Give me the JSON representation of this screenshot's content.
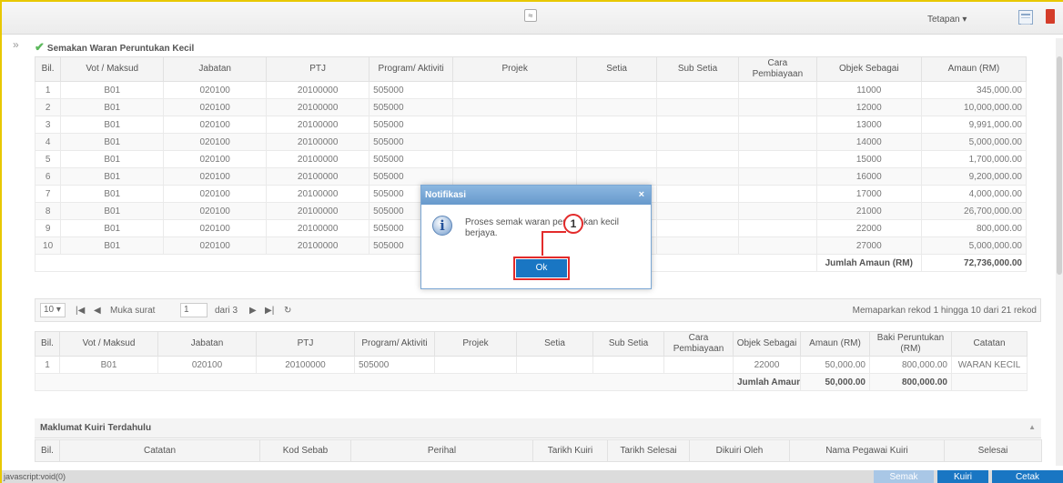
{
  "topbar": {
    "tetapan_label": "Tetapan ▾",
    "collapse_glyph": "≈"
  },
  "section": {
    "title": "Semakan Waran Peruntukan Kecil",
    "sidebar_toggle": "»"
  },
  "table1": {
    "headers": [
      "Bil.",
      "Vot / Maksud",
      "Jabatan",
      "PTJ",
      "Program/ Aktiviti",
      "Projek",
      "Setia",
      "Sub Setia",
      "Cara Pembiayaan",
      "Objek Sebagai",
      "Amaun (RM)"
    ],
    "rows": [
      [
        "1",
        "B01",
        "020100",
        "20100000",
        "505000",
        "",
        "",
        "",
        "",
        "11000",
        "345,000.00"
      ],
      [
        "2",
        "B01",
        "020100",
        "20100000",
        "505000",
        "",
        "",
        "",
        "",
        "12000",
        "10,000,000.00"
      ],
      [
        "3",
        "B01",
        "020100",
        "20100000",
        "505000",
        "",
        "",
        "",
        "",
        "13000",
        "9,991,000.00"
      ],
      [
        "4",
        "B01",
        "020100",
        "20100000",
        "505000",
        "",
        "",
        "",
        "",
        "14000",
        "5,000,000.00"
      ],
      [
        "5",
        "B01",
        "020100",
        "20100000",
        "505000",
        "",
        "",
        "",
        "",
        "15000",
        "1,700,000.00"
      ],
      [
        "6",
        "B01",
        "020100",
        "20100000",
        "505000",
        "",
        "",
        "",
        "",
        "16000",
        "9,200,000.00"
      ],
      [
        "7",
        "B01",
        "020100",
        "20100000",
        "505000",
        "",
        "",
        "",
        "",
        "17000",
        "4,000,000.00"
      ],
      [
        "8",
        "B01",
        "020100",
        "20100000",
        "505000",
        "",
        "",
        "",
        "",
        "21000",
        "26,700,000.00"
      ],
      [
        "9",
        "B01",
        "020100",
        "20100000",
        "505000",
        "",
        "",
        "",
        "",
        "22000",
        "800,000.00"
      ],
      [
        "10",
        "B01",
        "020100",
        "20100000",
        "505000",
        "",
        "",
        "",
        "",
        "27000",
        "5,000,000.00"
      ]
    ],
    "total_label": "Jumlah Amaun (RM)",
    "total_value": "72,736,000.00"
  },
  "pager": {
    "page_size": "10 ▾",
    "first": "|◀",
    "prev": "◀",
    "page_label": "Muka surat",
    "page_value": "1",
    "of_label": "dari 3",
    "next": "▶",
    "last": "▶|",
    "refresh": "↻",
    "summary": "Memaparkan rekod 1 hingga 10 dari 21 rekod"
  },
  "table2": {
    "headers": [
      "Bil.",
      "Vot / Maksud",
      "Jabatan",
      "PTJ",
      "Program/ Aktiviti",
      "Projek",
      "Setia",
      "Sub Setia",
      "Cara Pembiayaan",
      "Objek Sebagai",
      "Amaun (RM)",
      "Baki Peruntukan (RM)",
      "Catatan"
    ],
    "rows": [
      [
        "1",
        "B01",
        "020100",
        "20100000",
        "505000",
        "",
        "",
        "",
        "",
        "22000",
        "50,000.00",
        "800,000.00",
        "WARAN KECIL"
      ]
    ],
    "total_label": "Jumlah Amaun (F",
    "total_amaun": "50,000.00",
    "total_baki": "800,000.00"
  },
  "kuiri": {
    "title": "Maklumat Kuiri Terdahulu",
    "headers": [
      "Bil.",
      "Catatan",
      "Kod Sebab",
      "Perihal",
      "Tarikh Kuiri",
      "Tarikh Selesai",
      "Dikuiri Oleh",
      "Nama Pegawai Kuiri",
      "Selesai"
    ]
  },
  "modal": {
    "title": "Notifikasi",
    "close": "×",
    "message": "Proses semak waran peruntukan kecil berjaya.",
    "ok_label": "Ok",
    "icon": "info-icon"
  },
  "callout": {
    "number": "1"
  },
  "statusbar": {
    "text": "javascript:void(0)"
  },
  "actions": {
    "semak": "Semak",
    "kuiri": "Kuiri",
    "cetak": "Cetak"
  },
  "colors": {
    "accent": "#1976c3",
    "callout": "#e32b2b",
    "frame": "#e8c800",
    "check": "#5cb85c"
  }
}
